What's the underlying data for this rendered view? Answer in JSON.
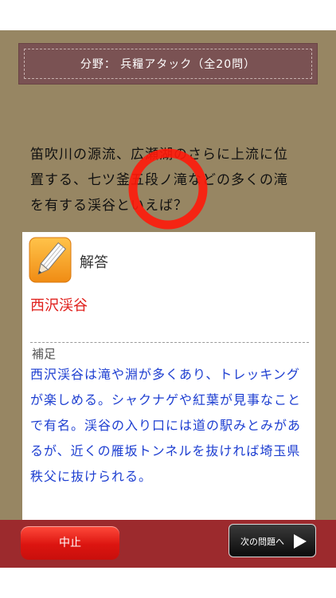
{
  "category": {
    "label": "分野：  兵糧アタック（全20問）"
  },
  "question": {
    "text": "笛吹川の源流、広瀬湖のさらに上流に位置する、七ツ釜五段ノ滝などの多くの滝を有する渓谷といえば？"
  },
  "answer": {
    "heading": "解答",
    "icon": "pencil-icon",
    "text": "西沢渓谷"
  },
  "supplement": {
    "label": "補足",
    "text": "西沢渓谷は滝や淵が多くあり、トレッキングが楽しめる。シャクナゲや紅葉が見事なことで有名。渓谷の入り口には道の駅みとみがあるが、近くの雁坂トンネルを抜ければ埼玉県秩父に抜けられる。"
  },
  "bottom_bar": {
    "stop_label": "中止",
    "next_label": "次の問題へ"
  },
  "colors": {
    "background": "#978663",
    "banner": "#7a5253",
    "answer_text": "#e0211d",
    "supplement_text": "#1e3fd1",
    "bottom_bar": "#9c2a2d",
    "marker_circle": "#ff1a0a"
  }
}
